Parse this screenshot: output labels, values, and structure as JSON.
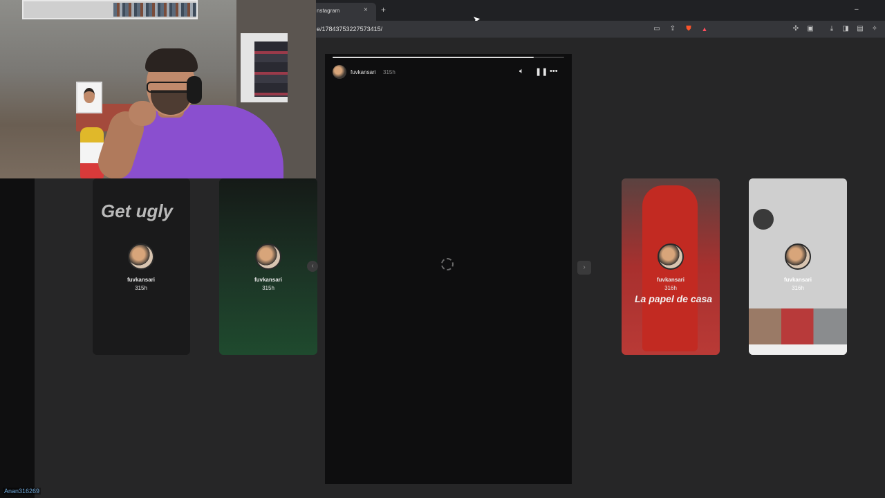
{
  "browser": {
    "tab_title": "nstagram",
    "tab_close": "×",
    "new_tab": "+",
    "minimize": "–",
    "url": "e/17843753227573415/"
  },
  "icons": {
    "toolbar_right": [
      "extensions-icon",
      "reading-list-icon",
      "download-icon",
      "sidebar-icon",
      "wallet-icon",
      "leo-icon"
    ],
    "toolbar_left": [
      "cast-icon",
      "share-icon",
      "brave-shields-icon",
      "brave-rewards-icon"
    ]
  },
  "player": {
    "username": "fuvkansari",
    "time": "315h",
    "progress_fraction": 0.87
  },
  "cards": [
    {
      "headline": "Get ugly",
      "username": "fuvkansari",
      "time": "315h"
    },
    {
      "username": "fuvkansari",
      "time": "315h"
    },
    {
      "username": "fuvkansari",
      "time": "316h",
      "overlay_text": "La papel de casa"
    },
    {
      "username": "fuvkansari",
      "time": "316h"
    }
  ],
  "watermark": "Anan316269",
  "colors": {
    "accent_brave": "#fb542b",
    "card_red": "#a8302e",
    "card_green": "#1f4a2e",
    "webcam_shirt": "#8a4fcf"
  }
}
